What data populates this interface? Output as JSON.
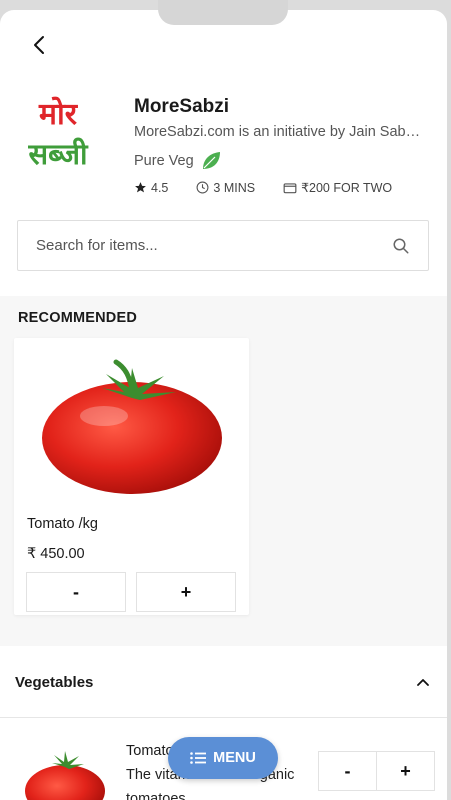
{
  "store": {
    "name": "MoreSabzi",
    "description": "MoreSabzi.com is an initiative by Jain Sabzi Bhandar",
    "pure_veg": "Pure Veg",
    "rating": "4.5",
    "time": "3 MINS",
    "cost": "₹200 FOR TWO",
    "logo_line1": "मोर",
    "logo_line2": "सब्जी"
  },
  "search": {
    "placeholder": "Search for items..."
  },
  "recommended": {
    "title": "RECOMMENDED",
    "items": [
      {
        "name": "Tomato /kg",
        "price": "₹ 450.00",
        "minus": "-",
        "plus": "+"
      }
    ]
  },
  "category": {
    "title": "Vegetables",
    "items": [
      {
        "name": "Tomato",
        "description": "The vitamin C rich organic",
        "description2": "tomatoes",
        "minus": "-",
        "plus": "+"
      }
    ]
  },
  "menu_button": {
    "label": "MENU"
  },
  "colors": {
    "accent": "#5b8fd6",
    "logo_red": "#e0252a",
    "logo_green": "#3f9d3a",
    "leaf_green": "#4caf50"
  },
  "icons": [
    "back-arrow-icon",
    "star-icon",
    "clock-icon",
    "wallet-icon",
    "search-icon",
    "leaf-icon",
    "chevron-up-icon",
    "list-icon"
  ]
}
